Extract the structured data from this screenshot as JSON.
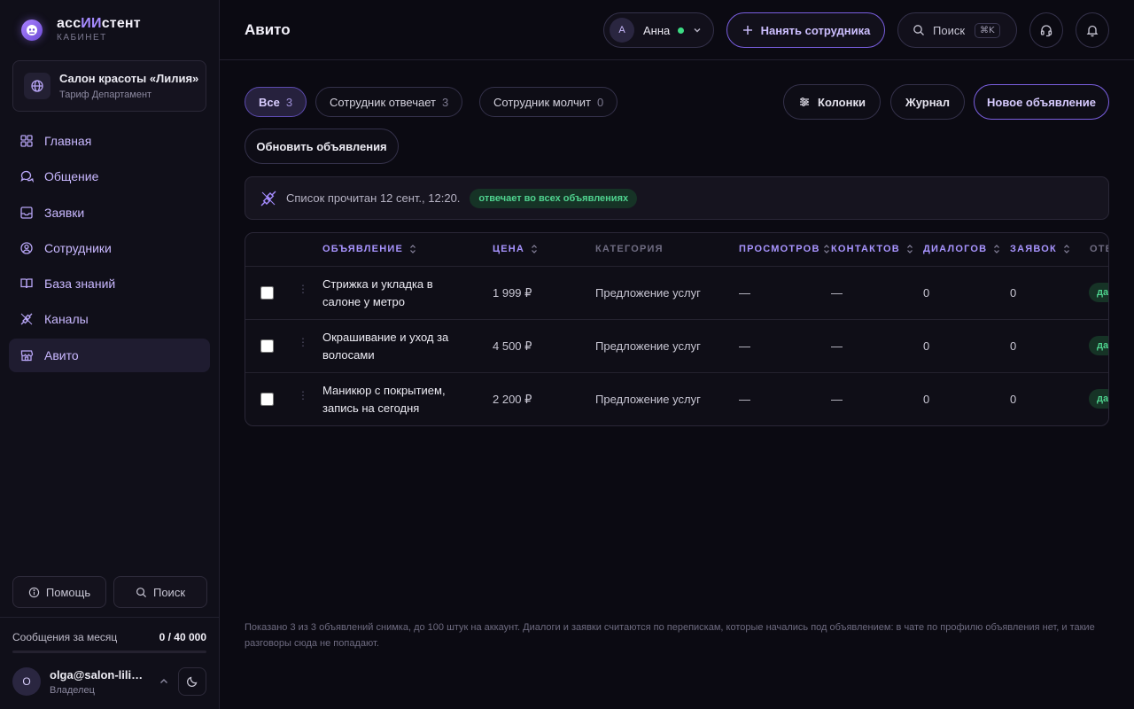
{
  "app": {
    "logo_prefix": "асс",
    "logo_accent": "ИИ",
    "logo_suffix": "стент",
    "logo_sub": "КАБИНЕТ"
  },
  "org": {
    "name": "Салон красоты «Лилия»",
    "plan": "Тариф Департамент"
  },
  "nav": [
    {
      "label": "Главная",
      "icon": "grid-icon"
    },
    {
      "label": "Общение",
      "icon": "chat-icon"
    },
    {
      "label": "Заявки",
      "icon": "inbox-icon"
    },
    {
      "label": "Сотрудники",
      "icon": "user-circle-icon"
    },
    {
      "label": "База знаний",
      "icon": "book-icon"
    },
    {
      "label": "Каналы",
      "icon": "plug-icon"
    },
    {
      "label": "Авито",
      "icon": "store-icon",
      "active": true
    }
  ],
  "sidebar_bottom": {
    "help_label": "Помощь",
    "search_label": "Поиск",
    "messages_label": "Сообщения за месяц",
    "messages_count": "0 / 40 000",
    "messages_used_fraction": 0,
    "user_initial": "O",
    "user_email": "olga@salon-liliya.ru",
    "user_role": "Владелец"
  },
  "topbar": {
    "title": "Авито",
    "staff_initial": "А",
    "staff_name": "Анна",
    "hire_label": "Нанять сотрудника",
    "search_label": "Поиск",
    "search_shortcut": "⌘K"
  },
  "filters": [
    {
      "label": "Все",
      "count": "3",
      "active": true
    },
    {
      "label": "Сотрудник отвечает",
      "count": "3"
    },
    {
      "label": "Сотрудник молчит",
      "count": "0"
    }
  ],
  "actions": {
    "columns_label": "Колонки",
    "journal_label": "Журнал",
    "new_label": "Новое объявление",
    "refresh_label": "Обновить объявления"
  },
  "info": {
    "text": "Список прочитан 12 сент., 12:20.",
    "badge": "отвечает во всех объявлениях"
  },
  "table": {
    "headers": {
      "listing": "ОБЪЯВЛЕНИЕ",
      "price": "ЦЕНА",
      "category": "КАТЕГОРИЯ",
      "views": "ПРОСМОТРОВ",
      "contacts": "КОНТАКТОВ",
      "dialogs": "ДИАЛОГОВ",
      "requests": "ЗАЯВОК",
      "answers": "ОТВ"
    },
    "rows": [
      {
        "title": "Стрижка и укладка в салоне у метро",
        "price": "1 999 ₽",
        "category": "Предложение услуг",
        "views": "—",
        "contacts": "—",
        "dialogs": "0",
        "requests": "0",
        "status": "да"
      },
      {
        "title": "Окрашивание и уход за волосами",
        "price": "4 500 ₽",
        "category": "Предложение услуг",
        "views": "—",
        "contacts": "—",
        "dialogs": "0",
        "requests": "0",
        "status": "да"
      },
      {
        "title": "Маникюр с покрытием, запись на сегодня",
        "price": "2 200 ₽",
        "category": "Предложение услуг",
        "views": "—",
        "contacts": "—",
        "dialogs": "0",
        "requests": "0",
        "status": "да"
      }
    ]
  },
  "footer_note": "Показано 3 из 3 объявлений снимка, до 100 штук на аккаунт. Диалоги и заявки считаются по перепискам, которые начались под объявлением: в чате по профилю объявления нет, и такие разговоры сюда не попадают.",
  "colors": {
    "accent": "#a68bff",
    "online": "#3ddc84",
    "badge_green": "#4fd38f"
  }
}
